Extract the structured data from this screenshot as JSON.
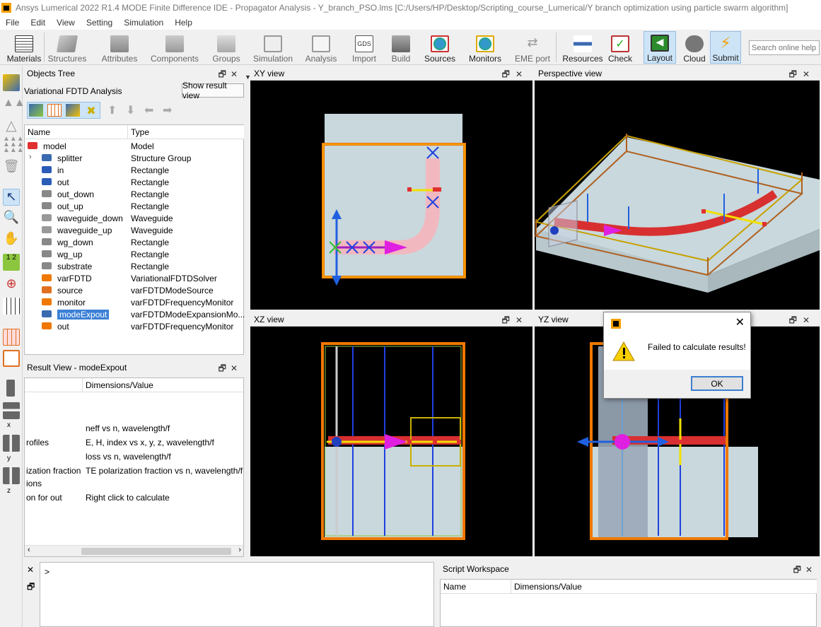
{
  "window": {
    "title": "Ansys Lumerical 2022 R1.4 MODE Finite Difference IDE - Propagator Analysis - Y_branch_PSO.lms [C:/Users/HP/Desktop/Scripting_course_Lumerical/Y branch optimization using particle swarm algorithm]"
  },
  "menu": [
    "File",
    "Edit",
    "View",
    "Setting",
    "Simulation",
    "Help"
  ],
  "toolbar": {
    "materials": "Materials",
    "structures": "Structures",
    "attributes": "Attributes",
    "components": "Components",
    "groups": "Groups",
    "simulation": "Simulation",
    "analysis": "Analysis",
    "import": "Import",
    "build": "Build",
    "sources": "Sources",
    "monitors": "Monitors",
    "eme_port": "EME port",
    "resources": "Resources",
    "check": "Check",
    "layout": "Layout",
    "cloud": "Cloud",
    "submit": "Submit",
    "gds_label": "GDS",
    "search_placeholder": "Search online help"
  },
  "objects_tree": {
    "title": "Objects Tree",
    "analysis_label": "Variational FDTD Analysis",
    "show_result_button": "Show result view",
    "col_name": "Name",
    "col_type": "Type",
    "items": [
      {
        "name": "model",
        "type": "Model"
      },
      {
        "name": "splitter",
        "type": "Structure Group"
      },
      {
        "name": "in",
        "type": "Rectangle"
      },
      {
        "name": "out",
        "type": "Rectangle"
      },
      {
        "name": "out_down",
        "type": "Rectangle"
      },
      {
        "name": "out_up",
        "type": "Rectangle"
      },
      {
        "name": "waveguide_down",
        "type": "Waveguide"
      },
      {
        "name": "waveguide_up",
        "type": "Waveguide"
      },
      {
        "name": "wg_down",
        "type": "Rectangle"
      },
      {
        "name": "wg_up",
        "type": "Rectangle"
      },
      {
        "name": "substrate",
        "type": "Rectangle"
      },
      {
        "name": "varFDTD",
        "type": "VariationalFDTDSolver"
      },
      {
        "name": "source",
        "type": "varFDTDModeSource"
      },
      {
        "name": "monitor",
        "type": "varFDTDFrequencyMonitor"
      },
      {
        "name": "modeExpout",
        "type": "varFDTDModeExpansionMo..."
      },
      {
        "name": "out",
        "type": "varFDTDFrequencyMonitor"
      }
    ]
  },
  "result_view": {
    "title": "Result View - modeExpout",
    "col_value": "Dimensions/Value",
    "rows": [
      {
        "name": "",
        "value": "neff vs n, wavelength/f"
      },
      {
        "name": "rofiles",
        "value": "E, H, index vs x, y, z, wavelength/f"
      },
      {
        "name": "",
        "value": "loss vs n, wavelength/f"
      },
      {
        "name": "ization fraction",
        "value": "TE polarization fraction vs n, wavelength/f"
      },
      {
        "name": "ions",
        "value": ""
      },
      {
        "name": "on for out",
        "value": "Right click to calculate"
      }
    ]
  },
  "views": {
    "xy": "XY view",
    "perspective": "Perspective view",
    "xz": "XZ view",
    "yz": "YZ view"
  },
  "dialog": {
    "message": "Failed to calculate results!",
    "ok": "OK"
  },
  "console": {
    "prompt": ">"
  },
  "script_workspace": {
    "title": "Script Workspace",
    "col_name": "Name",
    "col_value": "Dimensions/Value"
  },
  "axis_labels": {
    "x": "x",
    "y": "y",
    "z": "z",
    "half": "1",
    "half2": "2"
  }
}
